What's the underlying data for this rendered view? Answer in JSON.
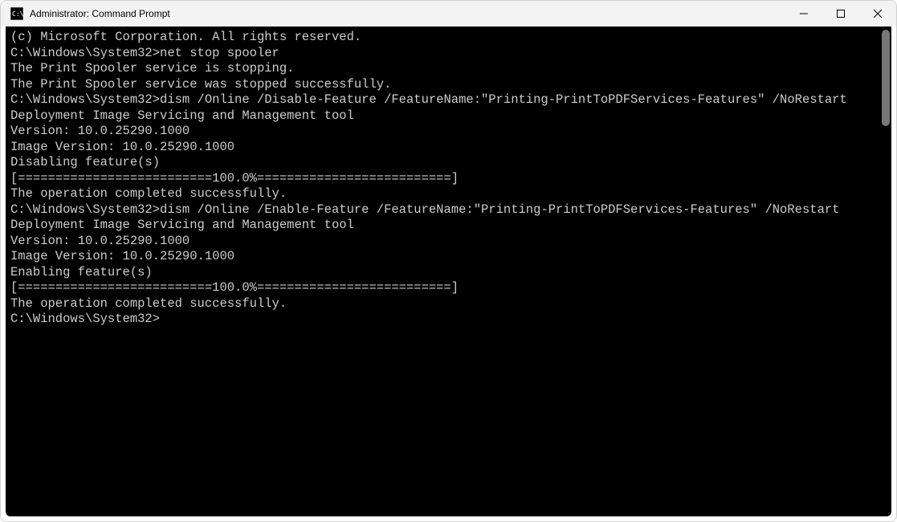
{
  "window": {
    "title": "Administrator: Command Prompt"
  },
  "terminal": {
    "prompt": "C:\\Windows\\System32>",
    "lines": [
      "(c) Microsoft Corporation. All rights reserved.",
      "",
      "C:\\Windows\\System32>net stop spooler",
      "The Print Spooler service is stopping.",
      "The Print Spooler service was stopped successfully.",
      "",
      "",
      "C:\\Windows\\System32>dism /Online /Disable-Feature /FeatureName:\"Printing-PrintToPDFServices-Features\" /NoRestart",
      "",
      "Deployment Image Servicing and Management tool",
      "Version: 10.0.25290.1000",
      "",
      "Image Version: 10.0.25290.1000",
      "",
      "Disabling feature(s)",
      "[==========================100.0%==========================]",
      "The operation completed successfully.",
      "",
      "C:\\Windows\\System32>dism /Online /Enable-Feature /FeatureName:\"Printing-PrintToPDFServices-Features\" /NoRestart",
      "",
      "Deployment Image Servicing and Management tool",
      "Version: 10.0.25290.1000",
      "",
      "Image Version: 10.0.25290.1000",
      "",
      "Enabling feature(s)",
      "[==========================100.0%==========================]",
      "The operation completed successfully.",
      "",
      "C:\\Windows\\System32>"
    ]
  }
}
